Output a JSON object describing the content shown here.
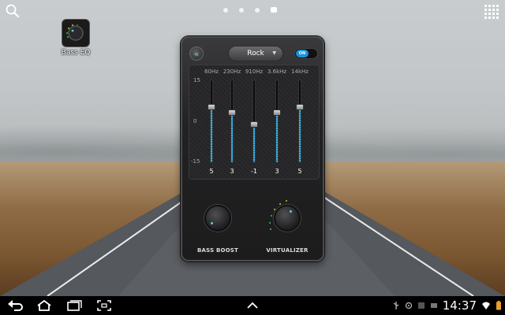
{
  "home": {
    "shortcut_label": "Bass EQ"
  },
  "widget": {
    "preset": "Rock",
    "toggle_label": "ON",
    "frequencies": [
      "60Hz",
      "230Hz",
      "910Hz",
      "3.6kHz",
      "14kHz"
    ],
    "scale": {
      "max": "15",
      "mid": "0",
      "min": "-15"
    },
    "bands": [
      5,
      3,
      -1,
      3,
      5
    ],
    "bands_text": [
      "5",
      "3",
      "-1",
      "3",
      "5"
    ],
    "bass_boost_label": "BASS BOOST",
    "virtualizer_label": "VIRTUALIZER",
    "colors": {
      "accent": "#38b7e8",
      "toggle_on": "#1e90d6"
    }
  },
  "status_bar": {
    "time": "14:37"
  }
}
